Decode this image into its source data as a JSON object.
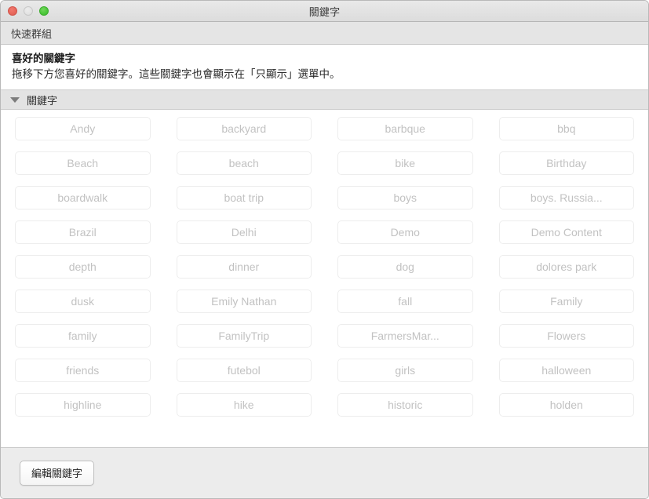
{
  "window": {
    "title": "關鍵字",
    "traffic_lights": [
      {
        "name": "close",
        "color": "#e8685c"
      },
      {
        "name": "minimize",
        "color": "#e3e3e3"
      },
      {
        "name": "zoom",
        "color": "#4ec83c"
      }
    ]
  },
  "quick_group": {
    "label": "快速群組"
  },
  "favorites": {
    "title": "喜好的關鍵字",
    "description": "拖移下方您喜好的關鍵字。這些關鍵字也會顯示在「只顯示」選單中。"
  },
  "keywords_section": {
    "title": "關鍵字",
    "disclosure_state": "expanded",
    "disclosure_icon": "triangle-down-icon"
  },
  "keywords": [
    "Andy",
    "backyard",
    "barbque",
    "bbq",
    "Beach",
    "beach",
    "bike",
    "Birthday",
    "boardwalk",
    "boat trip",
    "boys",
    "boys. Russia...",
    "Brazil",
    "Delhi",
    "Demo",
    "Demo Content",
    "depth",
    "dinner",
    "dog",
    "dolores park",
    "dusk",
    "Emily Nathan",
    "fall",
    "Family",
    "family",
    "FamilyTrip",
    "FarmersMar...",
    "Flowers",
    "friends",
    "futebol",
    "girls",
    "halloween",
    "highline",
    "hike",
    "historic",
    "holden"
  ],
  "bottom_bar": {
    "edit_keywords_label": "編輯關鍵字"
  },
  "theme": {
    "titlebar_bg": "#e3e3e3",
    "toolbar_bg": "#e5e5e5",
    "section_header_bg": "#e3e3e3",
    "content_bg": "#ffffff",
    "bottom_bar_bg": "#ececec",
    "chip_border": "#ededed",
    "chip_text": "#c2c2c2"
  }
}
